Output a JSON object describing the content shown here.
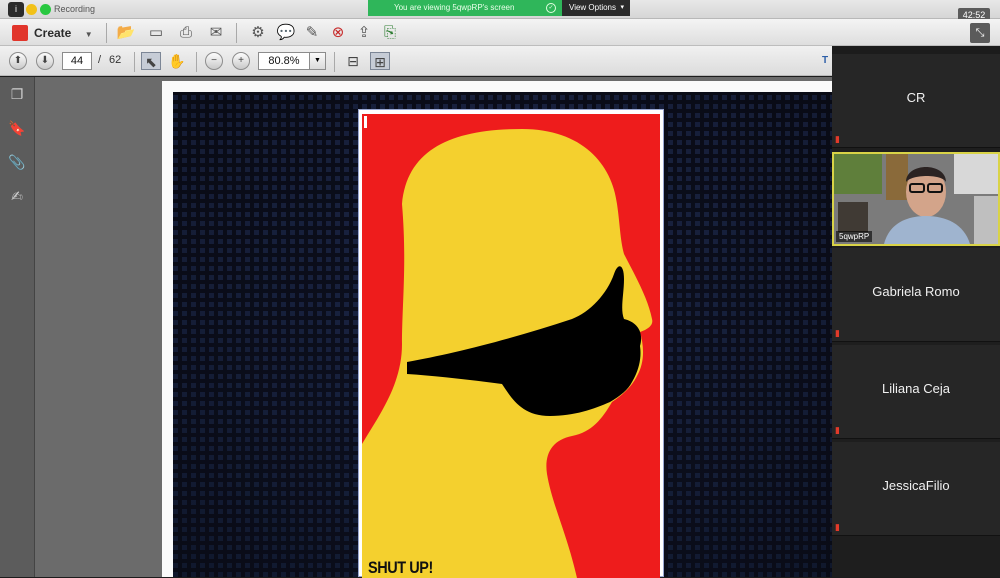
{
  "topbar": {
    "recording_label": "Recording",
    "share_banner": "You are viewing 5qwpRP's screen",
    "view_options": "View Options",
    "timer": "42:52"
  },
  "toolbar": {
    "create_label": "Create",
    "page_current": "44",
    "page_separator": "/",
    "page_total": "62",
    "zoom": "80.8%",
    "tools_label": "T"
  },
  "icons": {
    "create": "create-pdf-icon",
    "open": "folder-open-icon",
    "save": "save-icon",
    "print": "print-icon",
    "email": "email-icon",
    "settings": "gear-icon",
    "comment": "comment-icon",
    "sign": "sign-icon",
    "link": "link-icon",
    "export": "export-icon",
    "more": "more-icon"
  },
  "document": {
    "poster_title": "SHUT UP!"
  },
  "participants": [
    {
      "name": "CR",
      "video": false
    },
    {
      "name": "5qwpRP",
      "video": true
    },
    {
      "name": "Gabriela Romo",
      "video": false
    },
    {
      "name": "Liliana Ceja",
      "video": false
    },
    {
      "name": "JessicaFilio",
      "video": false
    }
  ],
  "colors": {
    "poster_red": "#ee1c1c",
    "poster_yellow": "#f4d02e",
    "share_green": "#2fb65a",
    "speaker_border": "#d9d347"
  }
}
